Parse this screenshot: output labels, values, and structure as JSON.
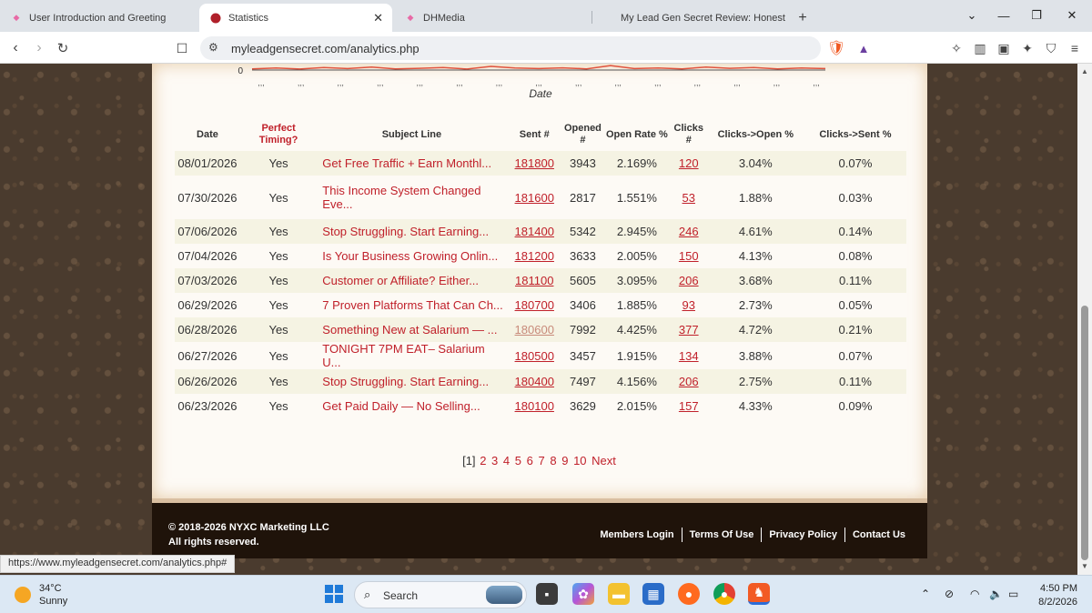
{
  "browser": {
    "tabs": [
      {
        "title": "User Introduction and Greeting",
        "active": false
      },
      {
        "title": "Statistics",
        "active": true
      },
      {
        "title": "DHMedia",
        "active": false
      },
      {
        "title": "My Lead Gen Secret Review: Honest",
        "active": false
      }
    ],
    "new_tab": "+",
    "url": "myleadgensecret.com/analytics.php"
  },
  "chart_data": {
    "type": "line",
    "xlabel": "Date",
    "y_ticks": [
      "0"
    ],
    "x_tick_labels": [
      ",,,",
      ",,,",
      ",,,",
      ",,,",
      ",,,",
      ",,,",
      ",,,",
      ",,,",
      ",,,",
      ",,,",
      ",,,",
      ",,,",
      ",,,",
      ",,,",
      ",,,"
    ],
    "series": [
      {
        "values": [
          0.05,
          0.08,
          0.04,
          0.1,
          0.06,
          0.12,
          0.05,
          0.07,
          0.1,
          0.04,
          0.15,
          0.08,
          0.06,
          0.09,
          0.05,
          0.18,
          0.06,
          0.08,
          0.05,
          0.12,
          0.07,
          0.1,
          0.05,
          0.08,
          0.06
        ],
        "color": "#e0533d"
      }
    ],
    "ylim": [
      0,
      1
    ]
  },
  "table": {
    "headers": [
      "Date",
      "Perfect Timing?",
      "Subject Line",
      "Sent #",
      "Opened #",
      "Open Rate %",
      "Clicks #",
      "Clicks->Open %",
      "Clicks->Sent %"
    ],
    "rows": [
      [
        "08/01/2026",
        "Yes",
        "Get Free Traffic + Earn Monthl...",
        "181800",
        "3943",
        "2.169%",
        "120",
        "3.04%",
        "0.07%"
      ],
      [
        "07/30/2026",
        "Yes",
        "This Income System Changed Eve...",
        "181600",
        "2817",
        "1.551%",
        "53",
        "1.88%",
        "0.03%"
      ],
      [
        "07/06/2026",
        "Yes",
        "Stop Struggling. Start Earning...",
        "181400",
        "5342",
        "2.945%",
        "246",
        "4.61%",
        "0.14%"
      ],
      [
        "07/04/2026",
        "Yes",
        "Is Your Business Growing Onlin...",
        "181200",
        "3633",
        "2.005%",
        "150",
        "4.13%",
        "0.08%"
      ],
      [
        "07/03/2026",
        "Yes",
        "Customer or Affiliate? Either...",
        "181100",
        "5605",
        "3.095%",
        "206",
        "3.68%",
        "0.11%"
      ],
      [
        "06/29/2026",
        "Yes",
        "7 Proven Platforms That Can Ch...",
        "180700",
        "3406",
        "1.885%",
        "93",
        "2.73%",
        "0.05%"
      ],
      [
        "06/28/2026",
        "Yes",
        "Something New at Salarium — ...",
        "180600",
        "7992",
        "4.425%",
        "377",
        "4.72%",
        "0.21%"
      ],
      [
        "06/27/2026",
        "Yes",
        "TONIGHT 7PM EAT– Salarium U...",
        "180500",
        "3457",
        "1.915%",
        "134",
        "3.88%",
        "0.07%"
      ],
      [
        "06/26/2026",
        "Yes",
        "Stop Struggling. Start Earning...",
        "180400",
        "7497",
        "4.156%",
        "206",
        "2.75%",
        "0.11%"
      ],
      [
        "06/23/2026",
        "Yes",
        "Get Paid Daily — No Selling...",
        "180100",
        "3629",
        "2.015%",
        "157",
        "4.33%",
        "0.09%"
      ]
    ]
  },
  "pager": {
    "current": "[1]",
    "pages": [
      "2",
      "3",
      "4",
      "5",
      "6",
      "7",
      "8",
      "9",
      "10"
    ],
    "next": "Next"
  },
  "footer": {
    "copyright": "© 2018-2026 NYXC Marketing LLC",
    "rights": "All rights reserved.",
    "links": [
      "Members Login",
      "Terms Of Use",
      "Privacy Policy",
      "Contact Us"
    ]
  },
  "status_url": "https://www.myleadgensecret.com/analytics.php#",
  "taskbar": {
    "weather_temp": "34°C",
    "weather_desc": "Sunny",
    "search_label": "Search",
    "time": "4:50 PM",
    "date": "8/2/2026"
  },
  "colors": {
    "accent_red": "#c0202a",
    "footer_bg": "#1f130a",
    "row_alt": "#f5f3e3"
  }
}
